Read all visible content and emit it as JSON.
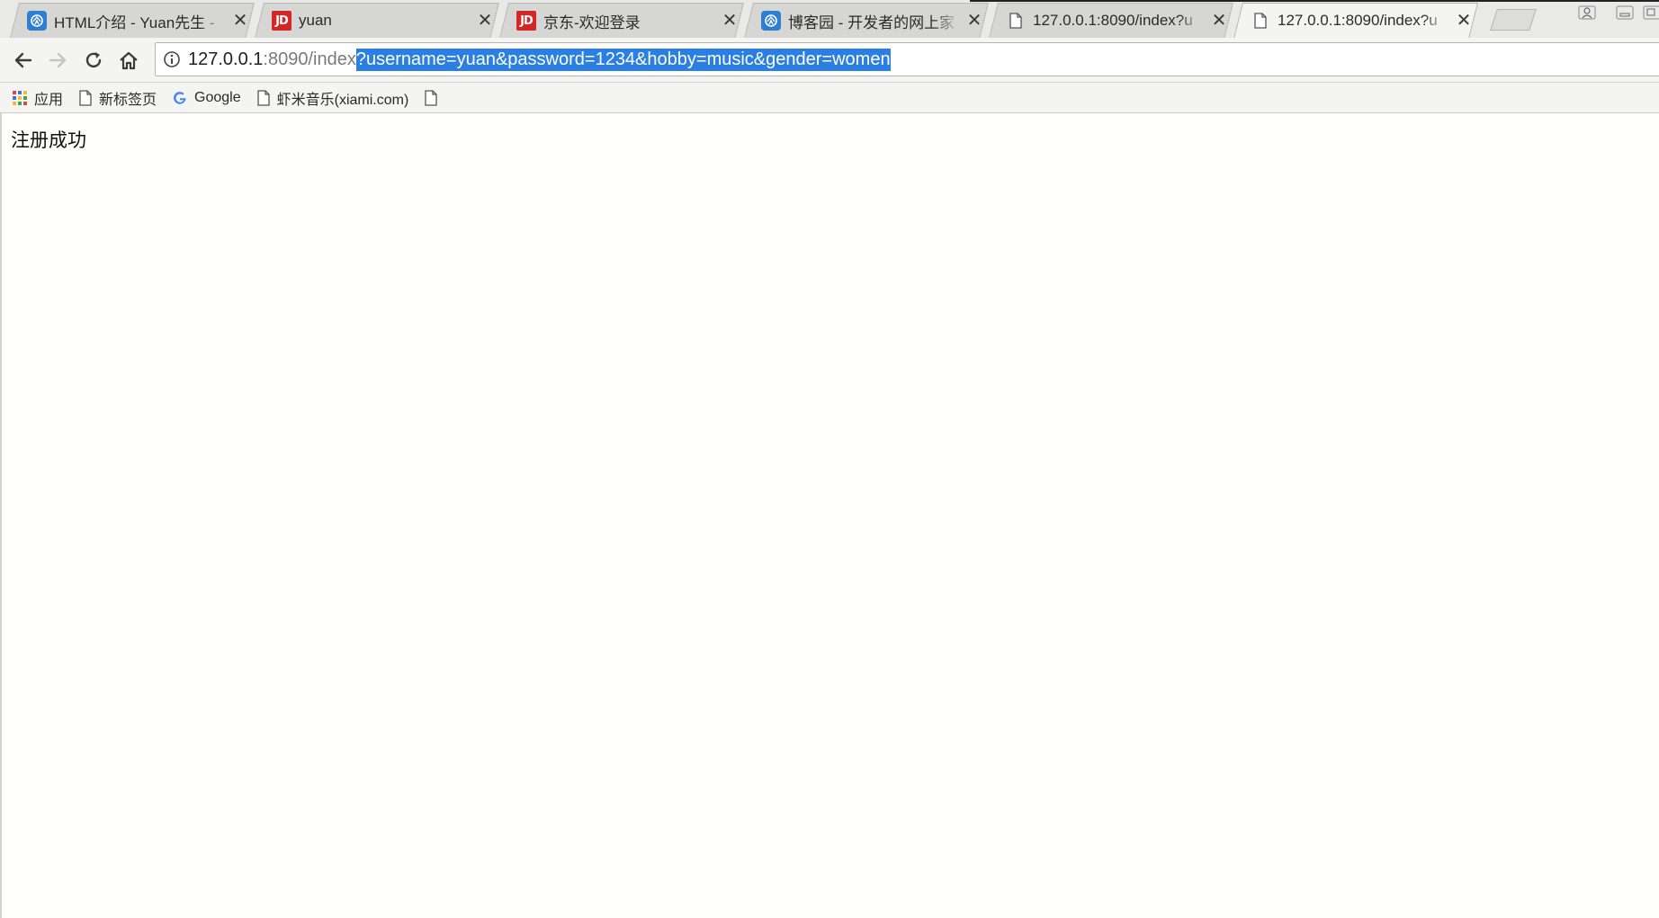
{
  "tabs": [
    {
      "icon": "cnblogs-icon",
      "title": "HTML介绍 - Yuan先生 -",
      "active": false
    },
    {
      "icon": "jd-icon",
      "title": "yuan",
      "active": false
    },
    {
      "icon": "jd-icon",
      "title": "京东-欢迎登录",
      "active": false
    },
    {
      "icon": "cnblogs-icon",
      "title": "博客园 - 开发者的网上家",
      "active": false
    },
    {
      "icon": "page-icon",
      "title": "127.0.0.1:8090/index?u",
      "active": false
    },
    {
      "icon": "page-icon",
      "title": "127.0.0.1:8090/index?u",
      "active": true
    }
  ],
  "tab_close_glyph": "✕",
  "jd_logo_text": "JD",
  "address_bar": {
    "host": "127.0.0.1",
    "path": ":8090/index",
    "selected_query": "?username=yuan&password=1234&hobby=music&gender=women"
  },
  "bookmarks": [
    {
      "icon": "apps-grid-icon",
      "label": "应用"
    },
    {
      "icon": "page-icon",
      "label": "新标签页"
    },
    {
      "icon": "google-icon",
      "label": "Google"
    },
    {
      "icon": "page-icon",
      "label": "虾米音乐(xiami.com)"
    },
    {
      "icon": "page-icon",
      "label": ""
    }
  ],
  "page": {
    "message": "注册成功"
  },
  "colors": {
    "selection": "#2b7fe3",
    "jd_red": "#d42725",
    "cnblogs_blue": "#2d7fd2"
  }
}
